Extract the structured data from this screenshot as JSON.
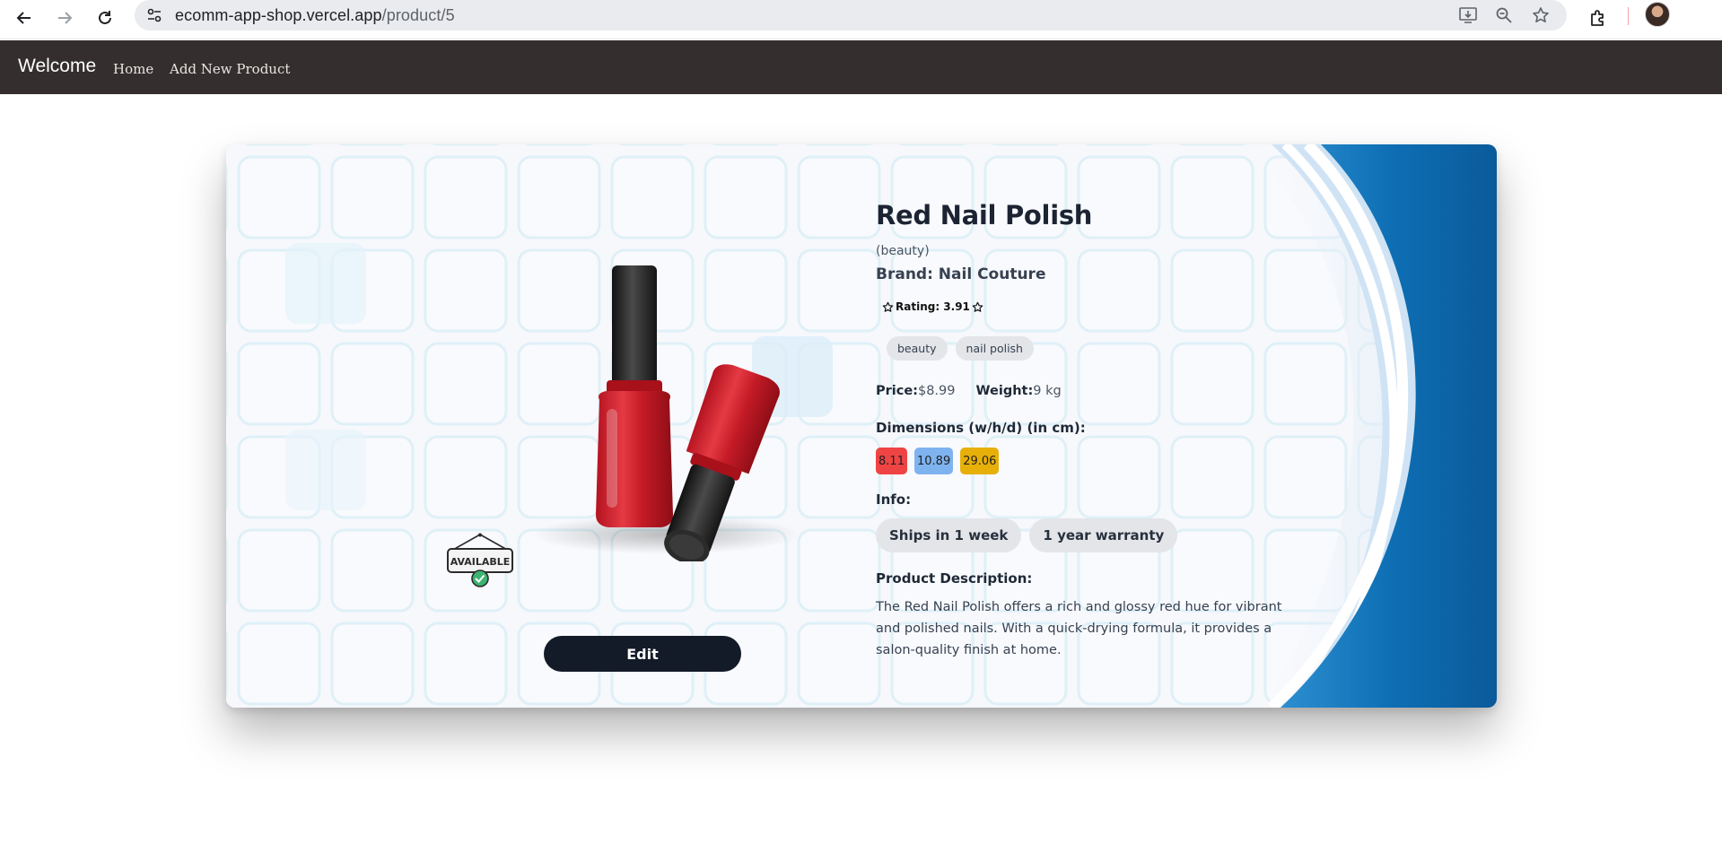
{
  "browser": {
    "url_host": "ecomm-app-shop.vercel.app",
    "url_path": "/product/5",
    "icons": [
      "back-arrow-icon",
      "forward-arrow-icon",
      "reload-icon",
      "site-settings-icon",
      "install-app-icon",
      "zoom-icon",
      "bookmark-star-icon",
      "extensions-icon",
      "profile-avatar"
    ]
  },
  "navbar": {
    "brand": "Welcome",
    "links": [
      "Home",
      "Add New Product"
    ]
  },
  "product": {
    "title": "Red Nail Polish",
    "category": "(beauty)",
    "brand": "Brand: Nail Couture",
    "rating_text": "Rating: 3.91",
    "tags": [
      "beauty",
      "nail polish"
    ],
    "price_label": "Price:",
    "price_value": "$8.99",
    "weight_label": "Weight:",
    "weight_value": "9 kg",
    "dimensions_label": "Dimensions (w/h/d) (in cm):",
    "dimensions": [
      {
        "value": "8.11",
        "color": "#ef4444"
      },
      {
        "value": "10.89",
        "color": "#7fb3ef"
      },
      {
        "value": "29.06",
        "color": "#e7b008"
      }
    ],
    "info_label": "Info:",
    "info_chips": [
      "Ships in 1 week",
      "1 year warranty"
    ],
    "description_label": "Product Description:",
    "description": "The Red Nail Polish offers a rich and glossy red hue for vibrant and polished nails. With a quick-drying formula, it provides a salon-quality finish at home.",
    "availability_badge": "AVAILABLE",
    "edit_label": "Edit"
  },
  "colors": {
    "navbar_bg": "#342f2e",
    "edit_button_bg": "#131a28",
    "wave_blue": "#0b6fb4"
  }
}
